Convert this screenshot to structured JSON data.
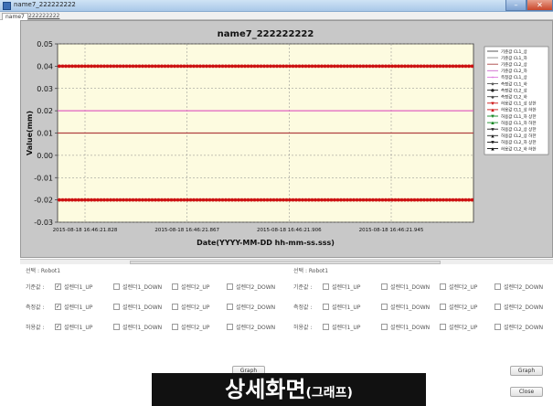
{
  "window": {
    "title": "name7_222222222",
    "minimize_label": "–",
    "close_label": "✕"
  },
  "tabs": [
    {
      "label": "name7"
    },
    {
      "label": "222222222"
    }
  ],
  "chart_data": {
    "type": "line",
    "title": "name7_222222222",
    "xlabel": "Date(YYYY-MM-DD hh-mm-ss.sss)",
    "ylabel": "Value(mm)",
    "ylim": [
      -0.03,
      0.05
    ],
    "yticks": [
      "0.05",
      "0.04",
      "0.03",
      "0.02",
      "0.01",
      "0.00",
      "-0.01",
      "-0.02",
      "-0.03"
    ],
    "xticks": [
      "2015-08-18 16:46:21.828",
      "2015-08-18 16:46:21.867",
      "2015-08-18 16:46:21.906",
      "2015-08-18 16:46:21.945"
    ],
    "grid": true,
    "legend_position": "right",
    "series": [
      {
        "level": 0.04,
        "color": "#cc1111",
        "style": "markers"
      },
      {
        "level": 0.02,
        "color": "#e060c0",
        "style": "line"
      },
      {
        "level": 0.01,
        "color": "#b04040",
        "style": "line"
      },
      {
        "level": -0.02,
        "color": "#cc1111",
        "style": "markers"
      }
    ],
    "legend": [
      {
        "label": "기준값 CL1_상",
        "color": "#444444",
        "marker": ""
      },
      {
        "label": "기준값 CL1_하",
        "color": "#888888",
        "marker": ""
      },
      {
        "label": "기준값 CL2_상",
        "color": "#aa4444",
        "marker": ""
      },
      {
        "label": "기준값 CL2_하",
        "color": "#cc66cc",
        "marker": ""
      },
      {
        "label": "측정값 CL1_상",
        "color": "#dd77dd",
        "marker": "+"
      },
      {
        "label": "측정값 CL1_하",
        "color": "#555555",
        "marker": "◆"
      },
      {
        "label": "측정값 CL2_상",
        "color": "#222222",
        "marker": "●"
      },
      {
        "label": "측정값 CL2_하",
        "color": "#444444",
        "marker": "◆"
      },
      {
        "label": "허용값 CL1_상 상한",
        "color": "#cc1111",
        "marker": "▼"
      },
      {
        "label": "허용값 CL1_상 하한",
        "color": "#cc1111",
        "marker": "▲"
      },
      {
        "label": "허용값 CL1_하 상한",
        "color": "#118822",
        "marker": "▼"
      },
      {
        "label": "허용값 CL1_하 하한",
        "color": "#118822",
        "marker": "▲"
      },
      {
        "label": "허용값 CL2_상 상한",
        "color": "#222222",
        "marker": "▼"
      },
      {
        "label": "허용값 CL2_상 하한",
        "color": "#222222",
        "marker": "▲"
      },
      {
        "label": "허용값 CL2_하 상한",
        "color": "#111111",
        "marker": "▼"
      },
      {
        "label": "허용값 CL2_하 하한",
        "color": "#111111",
        "marker": "▲"
      }
    ]
  },
  "left_panel": {
    "selection_label": "선택 : Robot1",
    "rows": [
      {
        "label": "기준값 :",
        "options": [
          {
            "label": "설렌더1_UP",
            "checked": "✓"
          },
          {
            "label": "설렌더1_DOWN",
            "checked": ""
          },
          {
            "label": "설렌더2_UP",
            "checked": ""
          },
          {
            "label": "설렌더2_DOWN",
            "checked": ""
          }
        ]
      },
      {
        "label": "측정값 :",
        "options": [
          {
            "label": "설렌더1_UP",
            "checked": "✓"
          },
          {
            "label": "설렌더1_DOWN",
            "checked": ""
          },
          {
            "label": "설렌더2_UP",
            "checked": ""
          },
          {
            "label": "설렌더2_DOWN",
            "checked": ""
          }
        ]
      },
      {
        "label": "허용값 :",
        "options": [
          {
            "label": "설렌더1_UP",
            "checked": "✓"
          },
          {
            "label": "설렌더1_DOWN",
            "checked": ""
          },
          {
            "label": "설렌더2_UP",
            "checked": ""
          },
          {
            "label": "설렌더2_DOWN",
            "checked": ""
          }
        ]
      }
    ],
    "graph_button": "Graph"
  },
  "right_panel": {
    "selection_label": "선택 : Robot1",
    "rows": [
      {
        "label": "기준값 :",
        "options": [
          {
            "label": "설렌더1_UP",
            "checked": ""
          },
          {
            "label": "설렌더1_DOWN",
            "checked": ""
          },
          {
            "label": "설렌더2_UP",
            "checked": ""
          },
          {
            "label": "설렌더2_DOWN",
            "checked": ""
          }
        ]
      },
      {
        "label": "측정값 :",
        "options": [
          {
            "label": "설렌더1_UP",
            "checked": ""
          },
          {
            "label": "설렌더1_DOWN",
            "checked": ""
          },
          {
            "label": "설렌더2_UP",
            "checked": ""
          },
          {
            "label": "설렌더2_DOWN",
            "checked": ""
          }
        ]
      },
      {
        "label": "허용값 :",
        "options": [
          {
            "label": "설렌더1_UP",
            "checked": ""
          },
          {
            "label": "설렌더1_DOWN",
            "checked": ""
          },
          {
            "label": "설렌더2_UP",
            "checked": ""
          },
          {
            "label": "설렌더2_DOWN",
            "checked": ""
          }
        ]
      }
    ],
    "graph_button": "Graph",
    "close_button": "Close"
  },
  "caption": {
    "main": "상세화면",
    "sub": "(그래프)"
  }
}
